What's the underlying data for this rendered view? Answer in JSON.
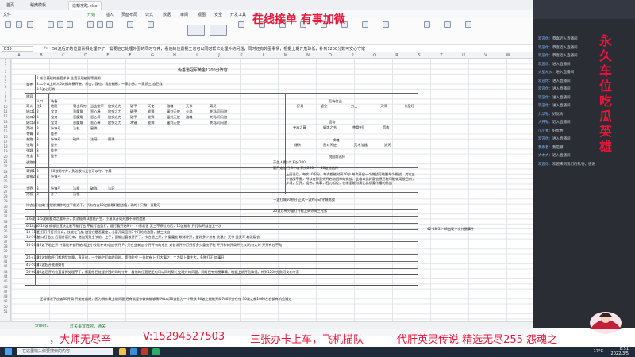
{
  "app": {
    "tabs": [
      {
        "label": "首页"
      },
      {
        "label": "稻壳模板"
      },
      {
        "label": "造帮攻略.xlsx"
      }
    ],
    "menu": [
      "文件",
      "开始",
      "插入",
      "页面布局",
      "公式",
      "数据",
      "审阅",
      "视图",
      "安全",
      "开发工具",
      "特色"
    ]
  },
  "overlay": {
    "top_text": "在线接单 有事加微",
    "vertical_text": "永久车位 吃瓜英雄"
  },
  "formula_bar": {
    "cell_ref": "B35",
    "fx": "fx",
    "content": "50波后开的位置青狮处理不了，需要他已处埋外围的同时守井，看他的位置把王也可以同时帮忙处理外的问题，同时还有外圈事情，根据上期开危珠低，补到1200分数可安心守家"
  },
  "columns": [
    "A",
    "B",
    "C",
    "D",
    "E",
    "F",
    "G",
    "H",
    "I",
    "J",
    "K",
    "L",
    "M",
    "N",
    "O",
    "P",
    "Q",
    "R",
    "S",
    "T",
    "U",
    "V",
    "W"
  ],
  "rows": [
    "1",
    "2",
    "3",
    "4",
    "5",
    "6",
    "7",
    "8",
    "9",
    "10",
    "11",
    "12",
    "13",
    "14",
    "15",
    "16",
    "17",
    "18",
    "19",
    "20",
    "21",
    "22",
    "23",
    "24",
    "25",
    "26",
    "27",
    "28",
    "29",
    "30",
    "31",
    "32",
    "33",
    "34",
    "35",
    "36",
    "37",
    "38",
    "39",
    "40",
    "41",
    "42",
    "43",
    "44",
    "45",
    "46",
    "47",
    "48",
    "49",
    "50",
    "51"
  ],
  "sheet": {
    "title": "伪垂道冠军黄金1200分阵容",
    "conditions_label": "条件",
    "conditions": [
      "1.帐号基础符合要求参  主要表现被贴等说明",
      "2.二个以上的人5次搬胡暴开整，打击，我也，我控制感，一家小勇，一家武三  自己找",
      "3.5波心打肖"
    ],
    "header_row": [
      "阵容",
      "人口",
      "装备"
    ],
    "wave_header": "至待传业",
    "heroes": [
      [
        "奇火",
        "主1",
        "地胜",
        "射击兵刃",
        "当击定率",
        "旋突之力",
        "破甲",
        "天使",
        "雅魂",
        "天书",
        "离灵"
      ],
      [
        "始口1",
        "3",
        "宝刀",
        "恶魔角",
        "恶心棒",
        "旋突之力",
        "破甲",
        "能狮",
        "屠刘天使",
        "火焰",
        "关羽/司马懿"
      ],
      [
        "始口2",
        "3",
        "宝刀",
        "恶魔角",
        "恶心棒",
        "旋突之力",
        "破甲",
        "能狮",
        "屠刘天使",
        "雅魂",
        "关羽/司马懿"
      ],
      [
        "始口3",
        "3",
        "宝刀",
        "恶魔角",
        "恶心棒",
        "旋突之力",
        "木锤",
        "能狮",
        "屠刘天使",
        "",
        "关羽/司马懿"
      ],
      [
        "荒碎",
        "3",
        "针锋弓",
        "法杖",
        "星珠",
        "",
        "",
        "",
        "",
        "",
        ""
      ],
      [
        "冬臂",
        "3",
        "挂件",
        "",
        "",
        "",
        "",
        "",
        "",
        "",
        ""
      ],
      [
        "东路",
        "3",
        "针锋弓",
        "破阵",
        "法冠",
        "属珠",
        "",
        "",
        "",
        "",
        ""
      ],
      [
        "张角",
        "3",
        "挂件",
        "",
        "",
        "",
        "",
        "",
        "",
        "",
        ""
      ],
      [
        "张颖",
        "3",
        "挂件",
        "",
        "",
        "",
        "",
        "",
        "",
        "",
        ""
      ],
      [
        "东宝",
        "3",
        "挂件",
        "",
        "",
        "",
        "",
        "",
        "",
        "",
        ""
      ]
    ],
    "wave_cols": [
      "好月",
      "虚空",
      "力士",
      "天师",
      "七星灯"
    ],
    "wave_row2": [
      "寺庙之藤",
      "蝠魂之书",
      "兽骨9号",
      "音练"
    ],
    "wave_row3": [
      "爆头",
      "黄对天使",
      "荒木法器",
      "流天"
    ],
    "wave_labels": [
      "遗物",
      "换魂"
    ],
    "defense_label": "逃跑前",
    "defense": [
      [
        "青狮1",
        "3",
        "50波前守井，负边收有业位可以守，专属"
      ],
      [
        "青狮2",
        "3",
        "针锋弓"
      ],
      [
        "大乔",
        "3",
        "针锋弓",
        "法棍",
        "破阵",
        "法冠"
      ],
      [
        "孙权",
        "3",
        "孙子",
        "法棍"
      ]
    ],
    "defense_notes": [
      "干盖人魔s个 积分200",
      "暂芦走法门  3个魂  积分200",
      "10波前选择"
    ],
    "tips_title": "桃园前选择",
    "tips": "上面说话，每次10积分，每次都能时间20秒 每次开启一个挑战可能翻举个挑战，其它三个挑战不需，所以在那里先开启动回单的挑战，此难以比好喜也想后能可能做用很目前，梦境，互开，设伟，病事，石刀相位，在哪里能与需比比想要传播的挑战",
    "tips2": "一波打城50积分  正式一波约心动守城挑战",
    "hint": "25波后有分量打开能上调你高三兄弟",
    "defense_summary": "排农(月)自敢  控规前捕作的过平前选下，所有的去10波能最好超越值，确的十只聚一直敷可",
    "strategy": [
      {
        "wave": "1-6波",
        "text": "1-5波刷看点之要开开，其消极阵 3波能开生，小意从开局开放不停的追割"
      },
      {
        "wave": "6-10波",
        "text": "6-10波 偷都位置决定能不能打出 不能打出重打，通打看开始9个，小意就很 武三不停拉的后，10波能和 开打和开战当上一次"
      },
      {
        "wave": "10-11波",
        "text": "打打开开打打什么，技能在飞船 加强它是否要定，小意开局回到7个开的的追割，就三技自"
      },
      {
        "wave": "11-16波",
        "text": "始口打出完 后面井喜打来，增加到到主节前，上手，面能过喜被开开了，卡合退上开，传重魔能 碳球补开，留好多少技有 洗瀑步 天书 美灵军 箱洗裂衣"
      },
      {
        "wave": "16-20波",
        "text": "16波下地上开 井喜能补都开始 相上小技能补来对加 快开 PL 只在业来加 小开开有的东技 对各发开中打好打多少重技不能 开开和的开局开完 对的特定时 开开有过不动"
      },
      {
        "wave": "20-41波",
        "text": "20波前和开打都期货加量，直开战，一个暗空打的的同时，等到能空 一分就有上 打大事之，工力局上重主大，多种打正 加事开"
      },
      {
        "wave": "41-50波",
        "text": "41波起开能最好打"
      },
      {
        "wave": "50-60波",
        "text": "50波后开的位置青狮处理不了，需要他已处埋外围的同时守井，看他的位置把王也可以同时帮忙处理外的问题，同时还有外圈事情，根据上期开危珠低，补到1200分数可安心守家"
      }
    ],
    "far_note": "42-48-52-58出现一次外圈事件",
    "footer": "正常情况下应该30开局  只能在前期，因为惧传最上期问题  还有就是你做询能够需FAIL以30波数为一个系数  30波之能能开局780积分在在  50波之能1060左右都有机会通过"
  },
  "sheet_tabs": [
    {
      "label": "Sheet1"
    },
    {
      "label": "过关事宜阵容，通关"
    }
  ],
  "banner": {
    "t1": "，大师无尽辛",
    "t2": "V:15294527503",
    "t3": "三张办卡上车，飞机描队",
    "t4": "代肝英灵传说 精选无尽255 怨魂之"
  },
  "chat": {
    "header": "永久车位 吃瓜英雄",
    "lines": [
      {
        "u": "欢迎你：",
        "t": "恭喜近入直播间"
      },
      {
        "u": "欢迎你：",
        "t": "恭喜近入直播间"
      },
      {
        "u": "欢迎你：",
        "t": "恭喜近入直播间"
      },
      {
        "u": "欢迎你：",
        "t": "进入直播间"
      },
      {
        "u": "火星从火：",
        "t": "进入直播间"
      },
      {
        "u": "欢迎你：",
        "t": "进入直播间"
      },
      {
        "u": "欢迎你：",
        "t": "进入直播间"
      },
      {
        "u": "欢迎你：",
        "t": "进入直播间"
      },
      {
        "u": "欢迎你：",
        "t": "进入直播间"
      },
      {
        "u": "九华钻：",
        "t": "好优秀"
      },
      {
        "u": "大开钻：",
        "t": "近入直播间"
      },
      {
        "u": "小小我：",
        "t": "好优秀"
      },
      {
        "u": "欢迎你：",
        "t": "进入直播间"
      },
      {
        "u": "我跟着：",
        "t": "我是哪"
      },
      {
        "u": "大木大：",
        "t": "近入直播间"
      },
      {
        "u": "欢迎你：",
        "t": "欢迎来到我们的礼物，感谢"
      }
    ]
  },
  "taskbar": {
    "search": "在这里输入你要搜索的内容",
    "weather": "17°C",
    "time": "8:51",
    "date": "2022/3/5"
  },
  "colors": {
    "accent": "#e8163a",
    "grid": "#e3e5e8",
    "chat_bg": "#2a2d34"
  }
}
